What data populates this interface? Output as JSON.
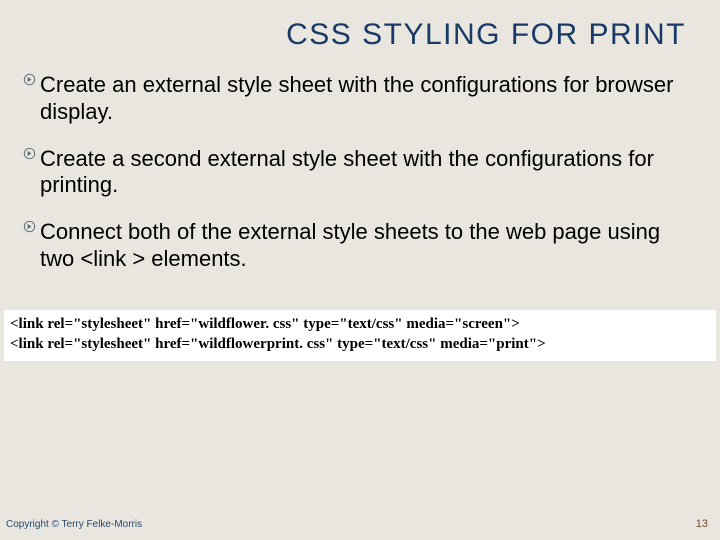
{
  "title": "CSS STYLING FOR PRINT",
  "bullets": {
    "b1": "Create an external style sheet with the configurations for browser display.",
    "b2": "Create a second external style sheet with the configurations for printing.",
    "b3": "Connect both of the external style sheets to the web page using two <link > elements."
  },
  "code": {
    "line1": "<link rel=\"stylesheet\" href=\"wildflower. css\" type=\"text/css\" media=\"screen\">",
    "line2": "<link rel=\"stylesheet\" href=\"wildflowerprint. css\" type=\"text/css\" media=\"print\">"
  },
  "footer": {
    "copyright": "Copyright © Terry Felke-Morris",
    "page": "13"
  }
}
